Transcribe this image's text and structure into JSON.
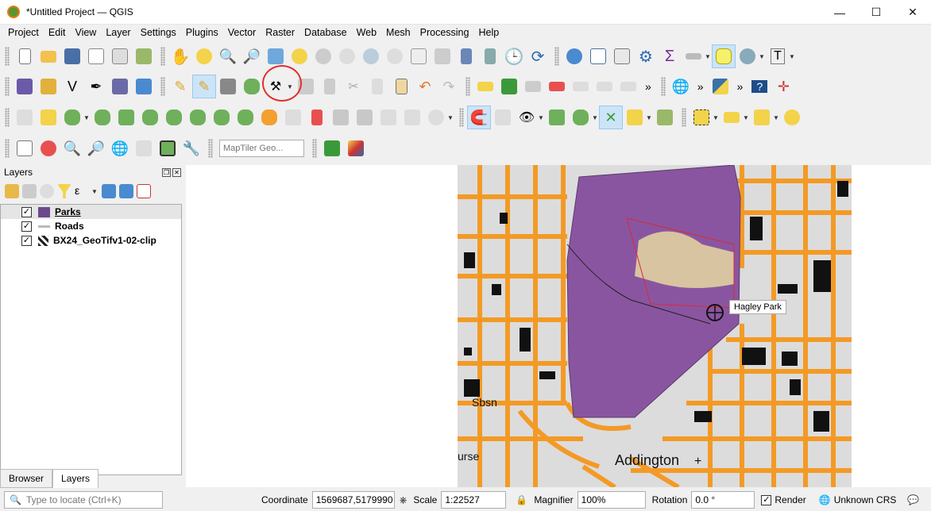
{
  "window": {
    "title": "*Untitled Project — QGIS",
    "minimize": "—",
    "maximize": "☐",
    "close": "✕"
  },
  "menu": [
    "Project",
    "Edit",
    "View",
    "Layer",
    "Settings",
    "Plugins",
    "Vector",
    "Raster",
    "Database",
    "Web",
    "Mesh",
    "Processing",
    "Help"
  ],
  "toolbar": {
    "locator_placeholder": "MapTiler Geo..."
  },
  "layers_panel": {
    "title": "Layers",
    "layers": [
      {
        "name": "Parks",
        "checked": "✓"
      },
      {
        "name": "Roads",
        "checked": "✓"
      },
      {
        "name": "BX24_GeoTifv1-02-clip",
        "checked": "✓"
      }
    ],
    "tabs": [
      "Browser",
      "Layers"
    ]
  },
  "map": {
    "tooltip": "Hagley Park",
    "labels": [
      "Addington",
      "Sbsn",
      "urse"
    ]
  },
  "statusbar": {
    "locate_placeholder": "Type to locate (Ctrl+K)",
    "coordinate_label": "Coordinate",
    "coordinate_value": "1569687,5179990",
    "scale_label": "Scale",
    "scale_value": "1:22527",
    "magnifier_label": "Magnifier",
    "magnifier_value": "100%",
    "rotation_label": "Rotation",
    "rotation_value": "0.0 °",
    "render_label": "Render",
    "render_checked": "✓",
    "crs_label": "Unknown CRS"
  },
  "colors": {
    "park": "#8a55a0",
    "roads": "#f39a26",
    "highlight": "#e0302e"
  }
}
